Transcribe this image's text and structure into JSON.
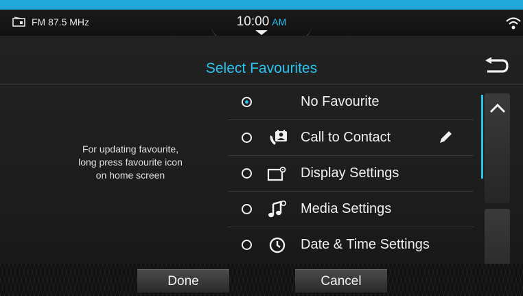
{
  "status": {
    "radio_station": "FM 87.5 MHz",
    "time": "10:00",
    "ampm": "AM"
  },
  "header": {
    "title": "Select Favourites"
  },
  "hint": {
    "lines": [
      "For updating favourite,",
      "long press favourite icon",
      "on home screen"
    ]
  },
  "favourites": [
    {
      "label": "No Favourite",
      "icon": "none",
      "selected": true
    },
    {
      "label": "Call to Contact",
      "icon": "call-contact-icon",
      "selected": false,
      "editable": true
    },
    {
      "label": "Display Settings",
      "icon": "display-settings-icon",
      "selected": false
    },
    {
      "label": "Media Settings",
      "icon": "media-settings-icon",
      "selected": false
    },
    {
      "label": "Date & Time Settings",
      "icon": "clock-icon",
      "selected": false
    }
  ],
  "footer": {
    "done_label": "Done",
    "cancel_label": "Cancel"
  },
  "colors": {
    "accent": "#2ac3ee",
    "top_strip": "#1fa8d8",
    "background": "#1f1f1f"
  }
}
